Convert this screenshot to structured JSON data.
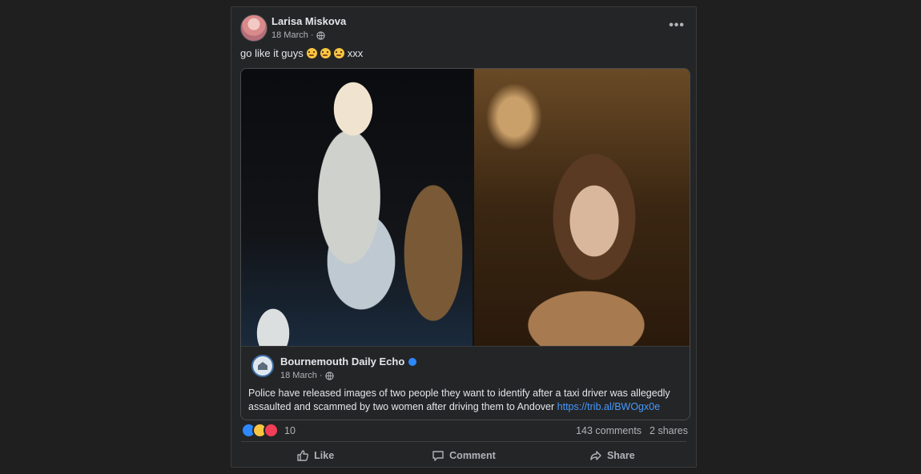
{
  "post": {
    "author": "Larisa Miskova",
    "date": "18 March",
    "meta_sep": "·",
    "more_label": "•••",
    "caption_text": "go like it guys",
    "caption_suffix": "xxx"
  },
  "link_card": {
    "page_name": "Bournemouth Daily Echo",
    "date": "18 March",
    "meta_sep": "·",
    "text": "Police have released images of two people they want to identify after a taxi driver was allegedly assaulted and scammed by two women after driving them to Andover",
    "url": "https://trib.al/BWOgx0e"
  },
  "engagement": {
    "reaction_count": "10",
    "comments": "143 comments",
    "shares": "2 shares"
  },
  "actions": {
    "like": "Like",
    "comment": "Comment",
    "share": "Share"
  },
  "colors": {
    "background": "#1f1f1f",
    "card": "#242526",
    "link": "#4599ff",
    "verified": "#2d88ff"
  }
}
